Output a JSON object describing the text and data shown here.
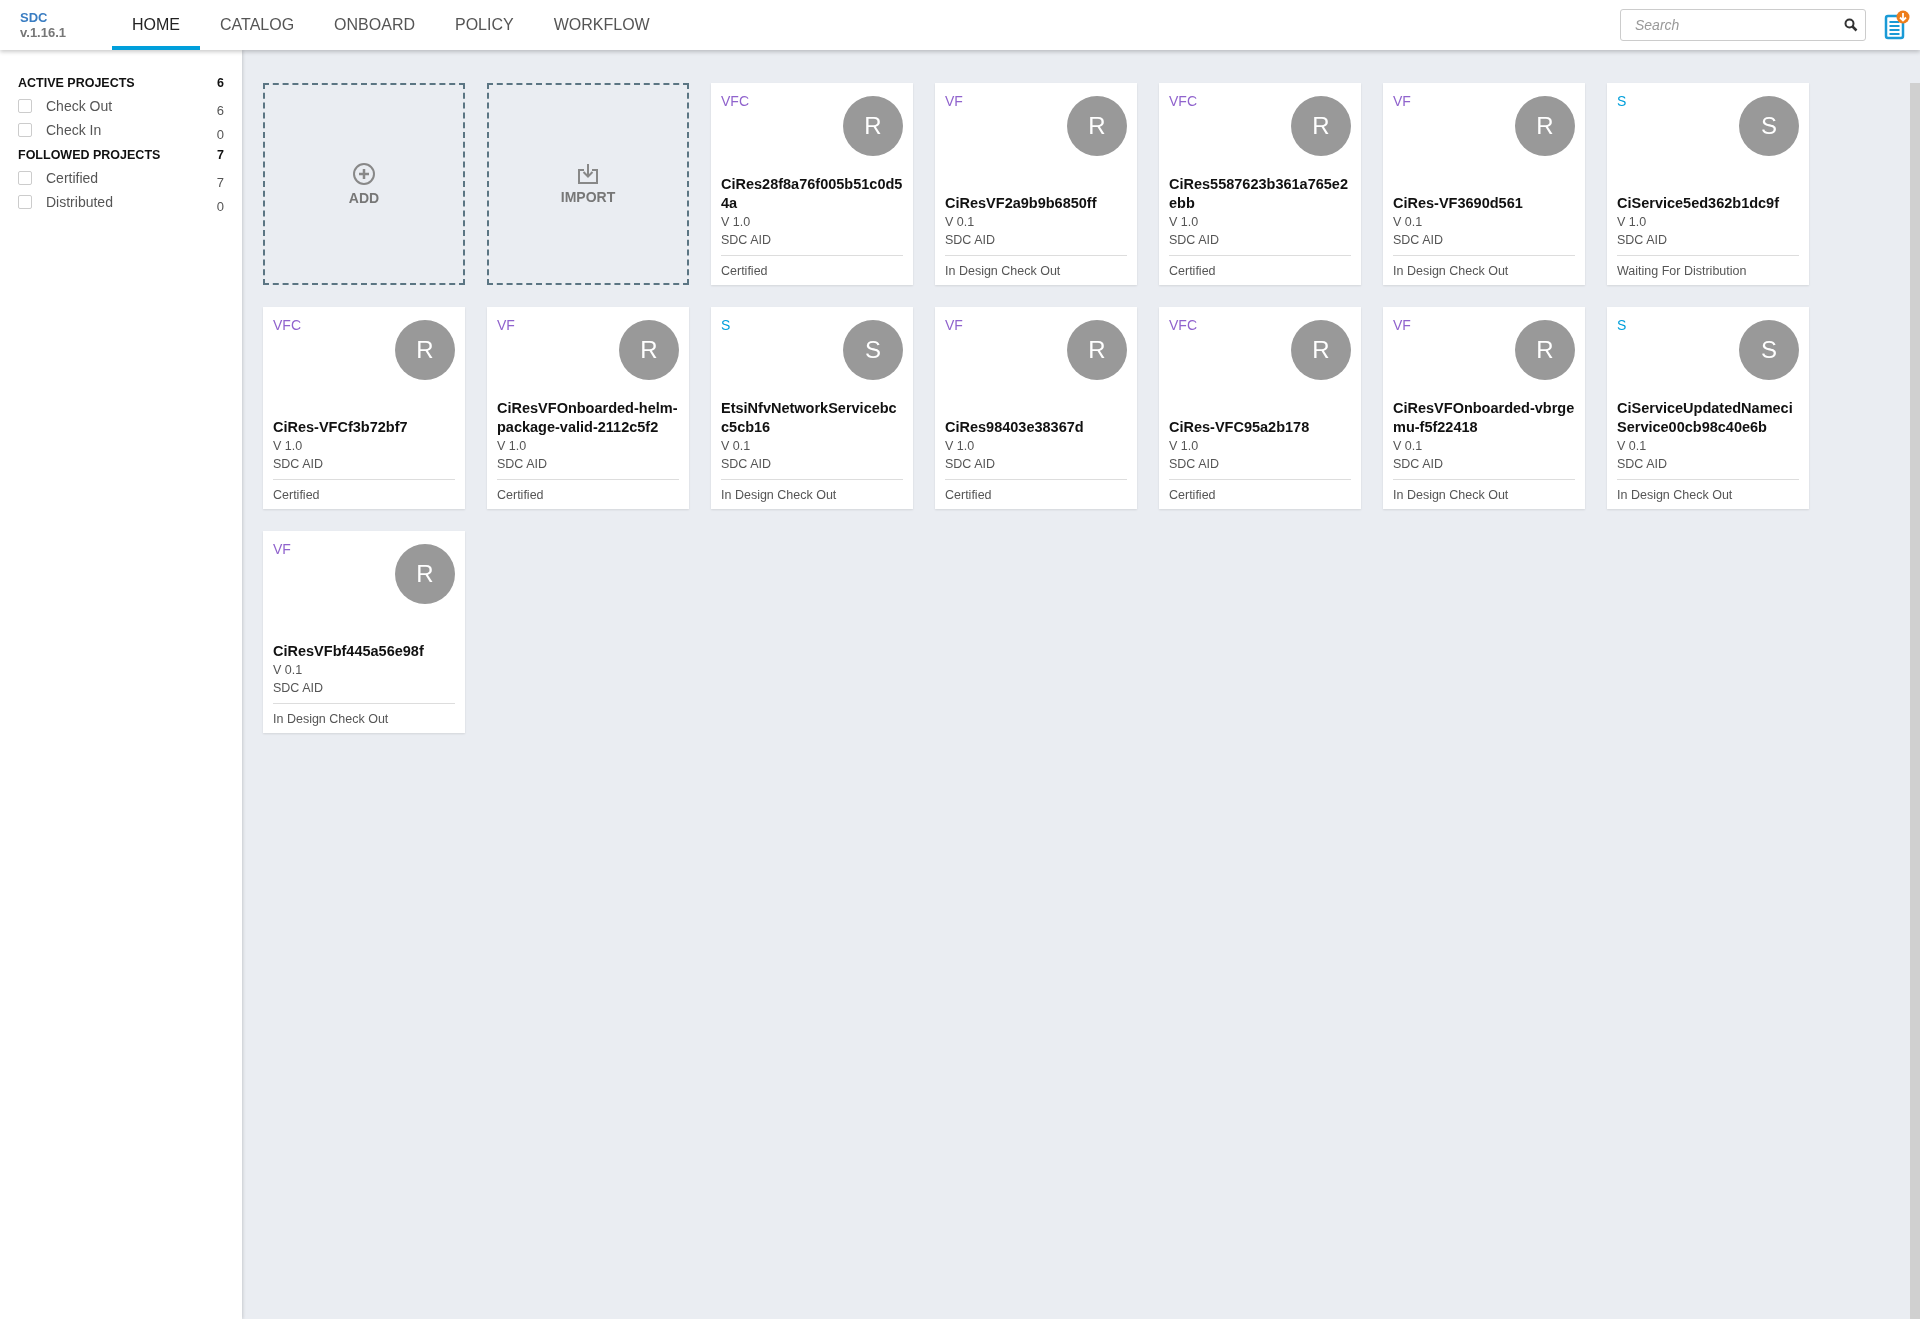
{
  "logo": {
    "title": "SDC",
    "version": "v.1.16.1"
  },
  "tabs": [
    {
      "label": "HOME",
      "selected": true
    },
    {
      "label": "CATALOG",
      "selected": false
    },
    {
      "label": "ONBOARD",
      "selected": false
    },
    {
      "label": "POLICY",
      "selected": false
    },
    {
      "label": "WORKFLOW",
      "selected": false
    }
  ],
  "search": {
    "placeholder": "Search"
  },
  "sidebar": [
    {
      "title": "ACTIVE PROJECTS",
      "count": "6",
      "items": [
        {
          "label": "Check Out",
          "count": "6",
          "checked": false
        },
        {
          "label": "Check In",
          "count": "0",
          "checked": false
        }
      ]
    },
    {
      "title": "FOLLOWED PROJECTS",
      "count": "7",
      "items": [
        {
          "label": "Certified",
          "count": "7",
          "checked": false
        },
        {
          "label": "Distributed",
          "count": "0",
          "checked": false
        }
      ]
    }
  ],
  "actions": [
    {
      "kind": "add",
      "label": "ADD"
    },
    {
      "kind": "import",
      "label": "IMPORT"
    }
  ],
  "cards": [
    {
      "type": "VFC",
      "color": "#9063cd",
      "avatar": "R",
      "name": "CiRes28f8a76f005b51c0d54a",
      "version": "V 1.0",
      "owner": "SDC AID",
      "status": "Certified"
    },
    {
      "type": "VF",
      "color": "#9063cd",
      "avatar": "R",
      "name": "CiResVF2a9b9b6850ff",
      "version": "V 0.1",
      "owner": "SDC AID",
      "status": "In Design Check Out"
    },
    {
      "type": "VFC",
      "color": "#9063cd",
      "avatar": "R",
      "name": "CiRes5587623b361a765e2ebb",
      "version": "V 1.0",
      "owner": "SDC AID",
      "status": "Certified"
    },
    {
      "type": "VF",
      "color": "#9063cd",
      "avatar": "R",
      "name": "CiRes-VF3690d561",
      "version": "V 0.1",
      "owner": "SDC AID",
      "status": "In Design Check Out"
    },
    {
      "type": "S",
      "color": "#009fdb",
      "avatar": "S",
      "name": "CiService5ed362b1dc9f",
      "version": "V 1.0",
      "owner": "SDC AID",
      "status": "Waiting For Distribution"
    },
    {
      "type": "VFC",
      "color": "#9063cd",
      "avatar": "R",
      "name": "CiRes-VFCf3b72bf7",
      "version": "V 1.0",
      "owner": "SDC AID",
      "status": "Certified"
    },
    {
      "type": "VF",
      "color": "#9063cd",
      "avatar": "R",
      "name": "CiResVFOnboarded-helm-package-valid-2112c5f2",
      "version": "V 1.0",
      "owner": "SDC AID",
      "status": "Certified"
    },
    {
      "type": "S",
      "color": "#009fdb",
      "avatar": "S",
      "name": "EtsiNfvNetworkServicebcc5cb16",
      "version": "V 0.1",
      "owner": "SDC AID",
      "status": "In Design Check Out"
    },
    {
      "type": "VF",
      "color": "#9063cd",
      "avatar": "R",
      "name": "CiRes98403e38367d",
      "version": "V 1.0",
      "owner": "SDC AID",
      "status": "Certified"
    },
    {
      "type": "VFC",
      "color": "#9063cd",
      "avatar": "R",
      "name": "CiRes-VFC95a2b178",
      "version": "V 1.0",
      "owner": "SDC AID",
      "status": "Certified"
    },
    {
      "type": "VF",
      "color": "#9063cd",
      "avatar": "R",
      "name": "CiResVFOnboarded-vbrgemu-f5f22418",
      "version": "V 0.1",
      "owner": "SDC AID",
      "status": "In Design Check Out"
    },
    {
      "type": "S",
      "color": "#009fdb",
      "avatar": "S",
      "name": "CiServiceUpdatedNameciService00cb98c40e6b",
      "version": "V 0.1",
      "owner": "SDC AID",
      "status": "In Design Check Out"
    },
    {
      "type": "VF",
      "color": "#9063cd",
      "avatar": "R",
      "name": "CiResVFbf445a56e98f",
      "version": "V 0.1",
      "owner": "SDC AID",
      "status": "In Design Check Out"
    }
  ]
}
